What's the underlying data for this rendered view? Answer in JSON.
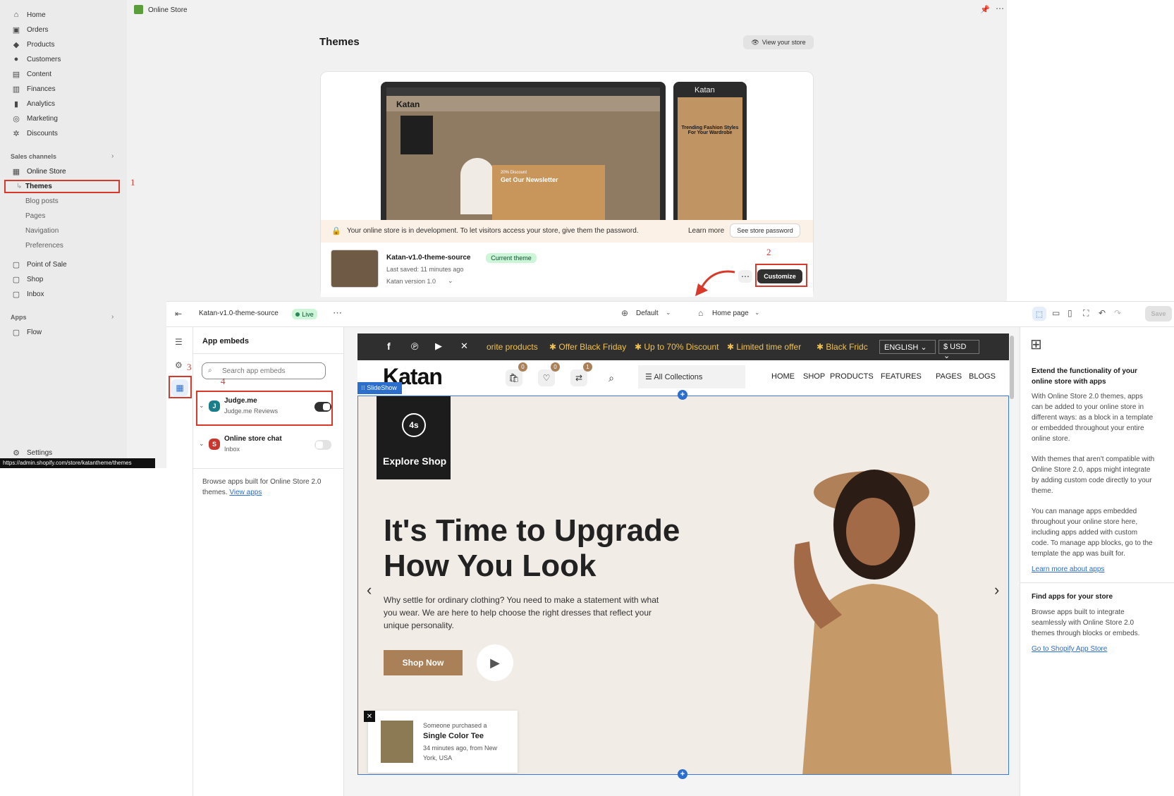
{
  "admin": {
    "sidebar": {
      "items": [
        {
          "label": "Home",
          "icon": "home-icon"
        },
        {
          "label": "Orders",
          "icon": "orders-icon"
        },
        {
          "label": "Products",
          "icon": "tag-icon"
        },
        {
          "label": "Customers",
          "icon": "person-icon"
        },
        {
          "label": "Content",
          "icon": "content-icon"
        },
        {
          "label": "Finances",
          "icon": "bank-icon"
        },
        {
          "label": "Analytics",
          "icon": "bar-chart-icon"
        },
        {
          "label": "Marketing",
          "icon": "target-icon"
        },
        {
          "label": "Discounts",
          "icon": "discount-icon"
        }
      ],
      "sales_channels_label": "Sales channels",
      "online_store_label": "Online Store",
      "sub_items": [
        "Themes",
        "Blog posts",
        "Pages",
        "Navigation",
        "Preferences"
      ],
      "channels": [
        {
          "label": "Point of Sale",
          "icon": "pos-icon"
        },
        {
          "label": "Shop",
          "icon": "shop-icon"
        },
        {
          "label": "Inbox",
          "icon": "inbox-icon"
        }
      ],
      "apps_label": "Apps",
      "apps": [
        {
          "label": "Flow",
          "icon": "flow-icon"
        }
      ],
      "settings_label": "Settings"
    },
    "topbar": {
      "title": "Online Store"
    },
    "page_title": "Themes",
    "view_store_label": "View your store",
    "dev_notice": "Your online store is in development. To let visitors access your store, give them the password.",
    "learn_more_label": "Learn more",
    "store_password_label": "See store password",
    "theme": {
      "name": "Katan-v1.0-theme-source",
      "badge": "Current theme",
      "last_saved": "Last saved: 11 minutes ago",
      "version": "Katan version 1.0"
    },
    "customize_label": "Customize",
    "status_url": "https://admin.shopify.com/store/katantheme/themes",
    "preview": {
      "logo": "Katan",
      "newsletter_discount": "20% Discount",
      "newsletter_title": "Get Our Newsletter",
      "mobile_heading": "Trending Fashion Styles For Your Wardrobe"
    }
  },
  "steps": [
    "1",
    "2",
    "3",
    "4"
  ],
  "editor": {
    "theme_name": "Katan-v1.0-theme-source",
    "live_label": "Live",
    "default_label": "Default",
    "page_label": "Home page",
    "save_label": "Save",
    "panel_title": "App embeds",
    "search_placeholder": "Search app embeds",
    "embeds": [
      {
        "name": "Judge.me",
        "sub": "Judge.me Reviews",
        "icon_letter": "J",
        "enabled": true
      },
      {
        "name": "Online store chat",
        "sub": "Inbox",
        "icon_letter": "S",
        "enabled": false
      }
    ],
    "browse_text": "Browse apps built for Online Store 2.0 themes.",
    "view_apps_label": "View apps",
    "right_panel": {
      "title": "Extend the functionality of your online store with apps",
      "p1": "With Online Store 2.0 themes, apps can be added to your online store in different ways: as a block in a template or embedded throughout your entire online store.",
      "p2": "With themes that aren't compatible with Online Store 2.0, apps might integrate by adding custom code directly to your theme.",
      "p3": "You can manage apps embedded throughout your online store here, including apps added with custom code. To manage app blocks, go to the template the app was built for.",
      "learn_link": "Learn more about apps",
      "find_title": "Find apps for your store",
      "find_text": "Browse apps built to integrate seamlessly with Online Store 2.0 themes through blocks or embeds.",
      "store_link": "Go to Shopify App Store"
    }
  },
  "store": {
    "announcements": [
      "orite products",
      "Offer Black Friday",
      "Up to 70% Discount",
      "Limited time offer",
      "Black Fridc"
    ],
    "language": "ENGLISH",
    "currency": "$ USD",
    "logo": "Katan",
    "cart_count": "0",
    "wishlist_count": "0",
    "compare_count": "1",
    "collections_label": "All Collections",
    "menu": [
      "HOME",
      "SHOP",
      "PRODUCTS",
      "FEATURES",
      "PAGES",
      "BLOGS"
    ],
    "section_tag": "SlideShow",
    "explore_logo": "4s",
    "explore_label": "Explore Shop",
    "hero_title_1": "It's Time to Upgrade",
    "hero_title_2": "How You Look",
    "hero_text": "Why settle for ordinary clothing? You need to make a statement with what you wear. We are here to help choose the right dresses that reflect your unique personality.",
    "shop_now_label": "Shop Now",
    "purchase": {
      "line1": "Someone purchased a",
      "product": "Single Color Tee",
      "line3": "34 minutes ago, from New",
      "line4": "York, USA"
    }
  },
  "colors": {
    "accent_red": "#d9392b",
    "brand_gold": "#a98057",
    "link_blue": "#2c6ecb"
  }
}
